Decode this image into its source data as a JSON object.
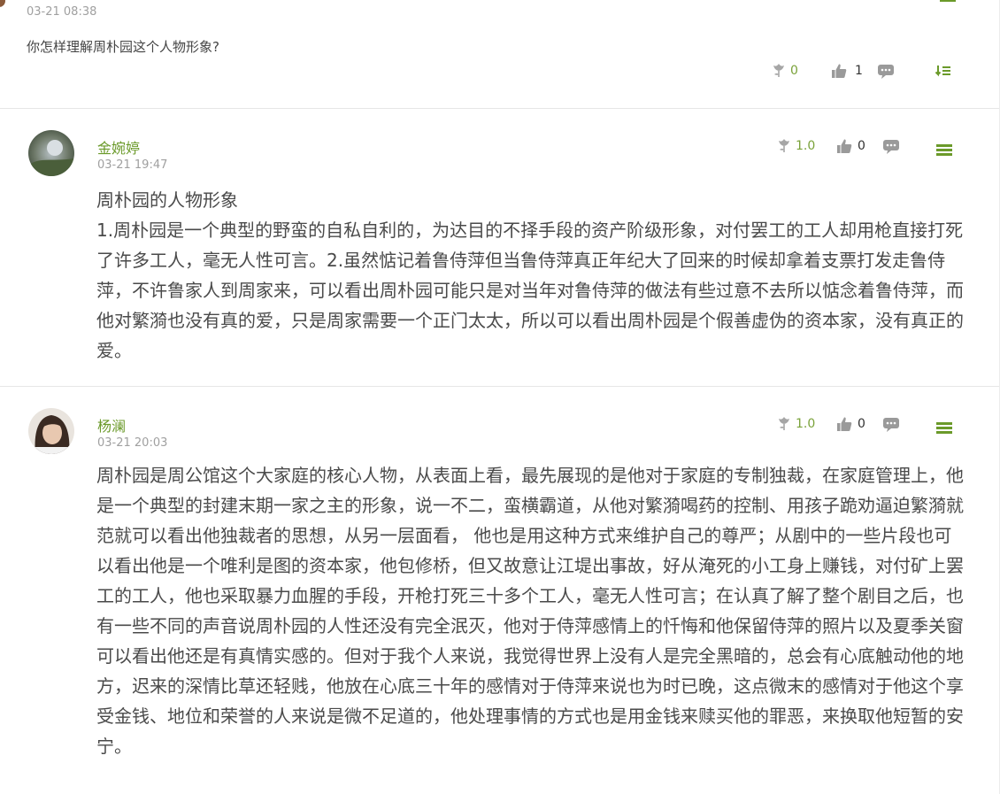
{
  "top": {
    "timestamp": "03-21 08:38",
    "question": "你怎样理解周朴园这个人物形象?",
    "flower_count": "0",
    "like_count": "1"
  },
  "comments": [
    {
      "username": "金婉婷",
      "timestamp": "03-21 19:47",
      "title": "周朴园的人物形象",
      "text": "1.周朴园是一个典型的野蛮的自私自利的，为达目的不择手段的资产阶级形象，对付罢工的工人却用枪直接打死了许多工人，毫无人性可言。2.虽然惦记着鲁侍萍但当鲁侍萍真正年纪大了回来的时候却拿着支票打发走鲁侍萍，不许鲁家人到周家来，可以看出周朴园可能只是对当年对鲁侍萍的做法有些过意不去所以惦念着鲁侍萍，而他对繁漪也没有真的爱，只是周家需要一个正门太太，所以可以看出周朴园是个假善虚伪的资本家，没有真正的爱。",
      "flower_score": "1.0",
      "like_count": "0"
    },
    {
      "username": "杨澜",
      "timestamp": "03-21 20:03",
      "text": "周朴园是周公馆这个大家庭的核心人物，从表面上看，最先展现的是他对于家庭的专制独裁，在家庭管理上，他是一个典型的封建末期一家之主的形象，说一不二，蛮横霸道，从他对繁漪喝药的控制、用孩子跪劝逼迫繁漪就范就可以看出他独裁者的思想，从另一层面看， 他也是用这种方式来维护自己的尊严；从剧中的一些片段也可以看出他是一个唯利是图的资本家，他包修桥，但又故意让江堤出事故，好从淹死的小工身上赚钱，对付矿上罢工的工人，他也采取暴力血腥的手段，开枪打死三十多个工人，毫无人性可言；在认真了解了整个剧目之后，也有一些不同的声音说周朴园的人性还没有完全泯灭，他对于侍萍感情上的忏悔和他保留侍萍的照片以及夏季关窗可以看出他还是有真情实感的。但对于我个人来说，我觉得世界上没有人是完全黑暗的，总会有心底触动他的地方，迟来的深情比草还轻贱，他放在心底三十年的感情对于侍萍来说也为时已晚，这点微末的感情对于他这个享受金钱、地位和荣誉的人来说是微不足道的，他处理事情的方式也是用金钱来赎买他的罪恶，来换取他短暂的安宁。",
      "flower_score": "1.0",
      "like_count": "0"
    }
  ],
  "icons": {
    "flower": "flower-icon",
    "like": "thumbs-up-icon",
    "reply": "comment-bubble-icon",
    "menu": "menu-icon",
    "sort": "sort-icon"
  },
  "colors": {
    "accent_green": "#6b9a2a",
    "muted_gray": "#a0a0a0",
    "icon_gray": "#8c8c8c"
  }
}
